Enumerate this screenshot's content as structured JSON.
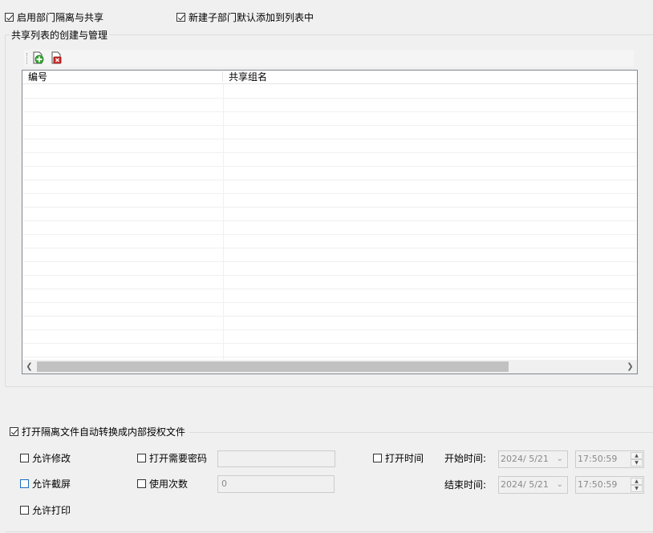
{
  "options": {
    "enable_isolation": {
      "label": "启用部门隔离与共享",
      "checked": true
    },
    "add_new_subdept": {
      "label": "新建子部门默认添加到列表中",
      "checked": true
    }
  },
  "share_group": {
    "title": "共享列表的创建与管理",
    "toolbar": {
      "add_icon": "add-icon",
      "delete_icon": "delete-icon"
    },
    "list": {
      "columns": [
        "编号",
        "共享组名"
      ],
      "rows": []
    }
  },
  "convert": {
    "label": "打开隔离文件自动转换成内部授权文件",
    "checked": true,
    "allow_edit": {
      "label": "允许修改",
      "checked": false
    },
    "allow_screenshot": {
      "label": "允许截屏",
      "checked": false
    },
    "allow_print": {
      "label": "允许打印",
      "checked": false
    },
    "require_password": {
      "label": "打开需要密码",
      "checked": false,
      "value": ""
    },
    "use_count": {
      "label": "使用次数",
      "checked": false,
      "value": "0"
    },
    "open_time": {
      "label": "打开时间",
      "checked": false
    },
    "start_time": {
      "label": "开始时间:",
      "date": "2024/  5/21",
      "time": "17:50:59"
    },
    "end_time": {
      "label": "结束时间:",
      "date": "2024/  5/21",
      "time": "17:50:59"
    }
  }
}
